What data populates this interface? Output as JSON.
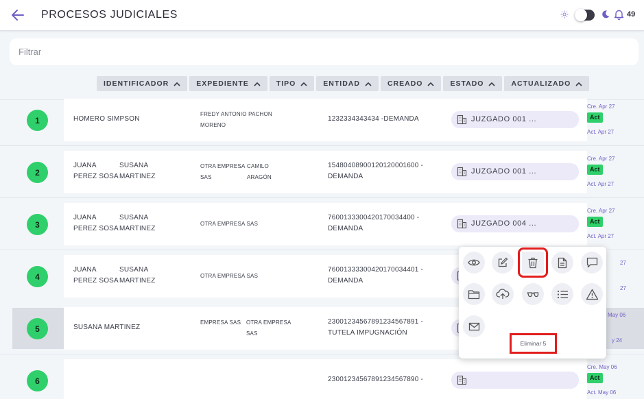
{
  "header": {
    "title": "PROCESOS JUDICIALES",
    "notification_count": "49"
  },
  "filter": {
    "placeholder": "Filtrar",
    "value": ""
  },
  "columns": [
    "IDENTIFICADOR",
    "EXPEDIENTE",
    "TIPO",
    "ENTIDAD",
    "CREADO",
    "ESTADO",
    "ACTUALIZADO"
  ],
  "rows": [
    {
      "number": "1",
      "demandante": [
        "HOMERO SIMPSON"
      ],
      "demandado": [
        "FREDY ANTONIO PACHON",
        "MORENO"
      ],
      "expediente": [
        "1232334343434 -DEMANDA"
      ],
      "entidad": "JUZGADO 001 ...",
      "creado": "Cre. Apr 27",
      "estado": "Act",
      "actualizado": "Act. Apr 27"
    },
    {
      "number": "2",
      "demandante": [
        "JUANA",
        "PEREZ SOSA",
        "SUSANA",
        "MARTINEZ"
      ],
      "demandado": [
        "OTRA EMPRESA",
        "SAS",
        "CAMILO",
        "ARAGÓN"
      ],
      "expediente": [
        "15480408900120120001600 -",
        "DEMANDA"
      ],
      "entidad": "JUZGADO 001 ...",
      "creado": "Cre. Apr 27",
      "estado": "Act",
      "actualizado": "Act. Apr 27"
    },
    {
      "number": "3",
      "demandante": [
        "JUANA",
        "PEREZ SOSA",
        "SUSANA",
        "MARTINEZ"
      ],
      "demandado": [
        "OTRA EMPRESA SAS"
      ],
      "expediente": [
        "76001333004201700344​00 -",
        "DEMANDA"
      ],
      "entidad": "JUZGADO 004 ...",
      "creado": "Cre. Apr 27",
      "estado": "Act",
      "actualizado": "Act. Apr 27"
    },
    {
      "number": "4",
      "demandante": [
        "JUANA",
        "PEREZ SOSA",
        "SUSANA",
        "MARTINEZ"
      ],
      "demandado": [
        "OTRA EMPRESA SAS"
      ],
      "expediente": [
        "76001333300420170034401 -",
        "DEMANDA"
      ],
      "entidad": "",
      "creado": "27",
      "estado": "",
      "actualizado": "27"
    },
    {
      "number": "5",
      "demandante": [
        "SUSANA MARTINEZ"
      ],
      "demandado": [
        "EMPRESA SAS",
        "OTRA EMPRESA",
        "SAS"
      ],
      "expediente": [
        "23001234567891234567891 -",
        "TUTELA IMPUGNACIÓN"
      ],
      "entidad": "",
      "creado": "May 06",
      "estado": "",
      "actualizado": "y 24"
    },
    {
      "number": "6",
      "demandante": [],
      "demandado": [],
      "expediente": [
        "23001234567891234567890 -"
      ],
      "entidad": "",
      "creado": "Cre. May 06",
      "estado": "Act",
      "actualizado": "Act. May 06"
    }
  ],
  "action_menu": {
    "icons": [
      "eye-icon",
      "edit-icon",
      "trash-icon",
      "document-icon",
      "comment-icon",
      "folder-icon",
      "cloud-upload-icon",
      "glasses-icon",
      "list-icon",
      "warning-icon",
      "mail-icon"
    ],
    "tooltip": "Eliminar 5"
  },
  "colors": {
    "accent": "#6f5fc6",
    "status_green": "#2fd06b",
    "highlight_red": "#e11d1d"
  }
}
